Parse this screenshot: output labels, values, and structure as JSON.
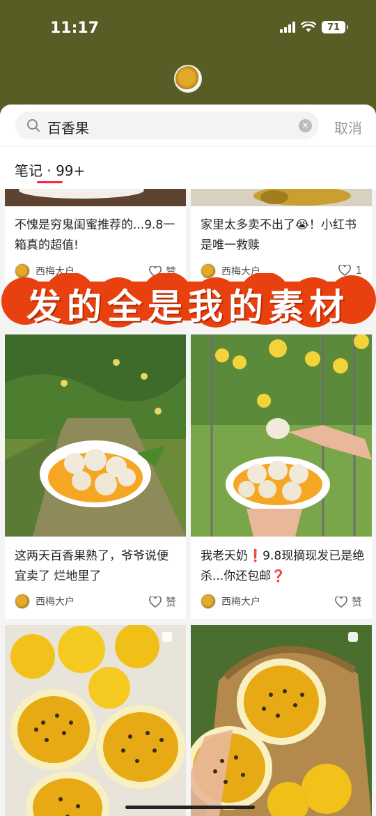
{
  "status_bar": {
    "time": "11:17",
    "battery": "71"
  },
  "search": {
    "query": "百香果",
    "cancel_label": "取消"
  },
  "tabs": {
    "notes_label": "笔记 · 99+"
  },
  "overlay_banner": {
    "text": "发的全是我的素材"
  },
  "cards": [
    {
      "title": "不愧是穷鬼闺蜜推荐的...9.8一箱真的超值!",
      "author": "西梅大户",
      "likes": "赞"
    },
    {
      "title": "家里太多卖不出了😭！小红书是唯一救赎",
      "author": "西梅大户",
      "likes": "1"
    },
    {
      "title": "这两天百香果熟了，爷爷说便宜卖了 烂地里了",
      "author": "西梅大户",
      "likes": "赞"
    },
    {
      "title": "我老天奶❗️9.8现摘现发已是绝杀...你还包邮❓",
      "author": "西梅大户",
      "likes": "赞"
    }
  ],
  "colors": {
    "status_bg": "#575d25",
    "accent": "#ff2442",
    "banner_bg": "#e8410f"
  }
}
